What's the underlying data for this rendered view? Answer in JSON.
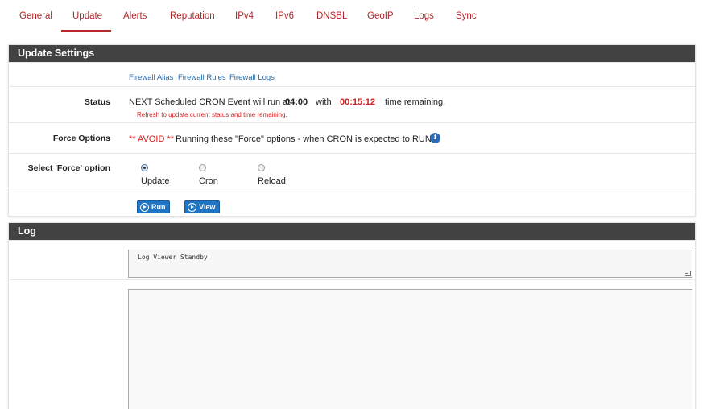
{
  "tabs": [
    {
      "label": "General"
    },
    {
      "label": "Update"
    },
    {
      "label": "Alerts"
    },
    {
      "label": "Reputation"
    },
    {
      "label": "IPv4"
    },
    {
      "label": "IPv6"
    },
    {
      "label": "DNSBL"
    },
    {
      "label": "GeoIP"
    },
    {
      "label": "Logs"
    },
    {
      "label": "Sync"
    }
  ],
  "active_tab": "Update",
  "update_settings": {
    "title": "Update Settings",
    "links": [
      "Firewall Alias",
      "Firewall Rules",
      "Firewall Logs"
    ],
    "status": {
      "label": "Status",
      "prefix": "NEXT Scheduled CRON Event will run at",
      "time": "04:00",
      "with": "with",
      "remaining": "00:15:12",
      "suffix": "time remaining.",
      "hint": "Refresh to update current status and time remaining."
    },
    "force_options": {
      "label": "Force Options",
      "avoid": "** AVOID **",
      "text": "Running these \"Force\" options - when CRON is expected to RUN!",
      "info_icon": "info-icon"
    },
    "select_force": {
      "label": "Select 'Force' option",
      "options": [
        "Update",
        "Cron",
        "Reload"
      ],
      "selected": "Update"
    },
    "buttons": {
      "run": "Run",
      "view": "View"
    }
  },
  "log": {
    "title": "Log",
    "viewer_text": "Log Viewer Standby"
  },
  "colors": {
    "accent": "#b0272a",
    "header_bg": "#424242",
    "link": "#2b6aa6",
    "button": "#1f74c3",
    "warning": "#d21e1e"
  }
}
